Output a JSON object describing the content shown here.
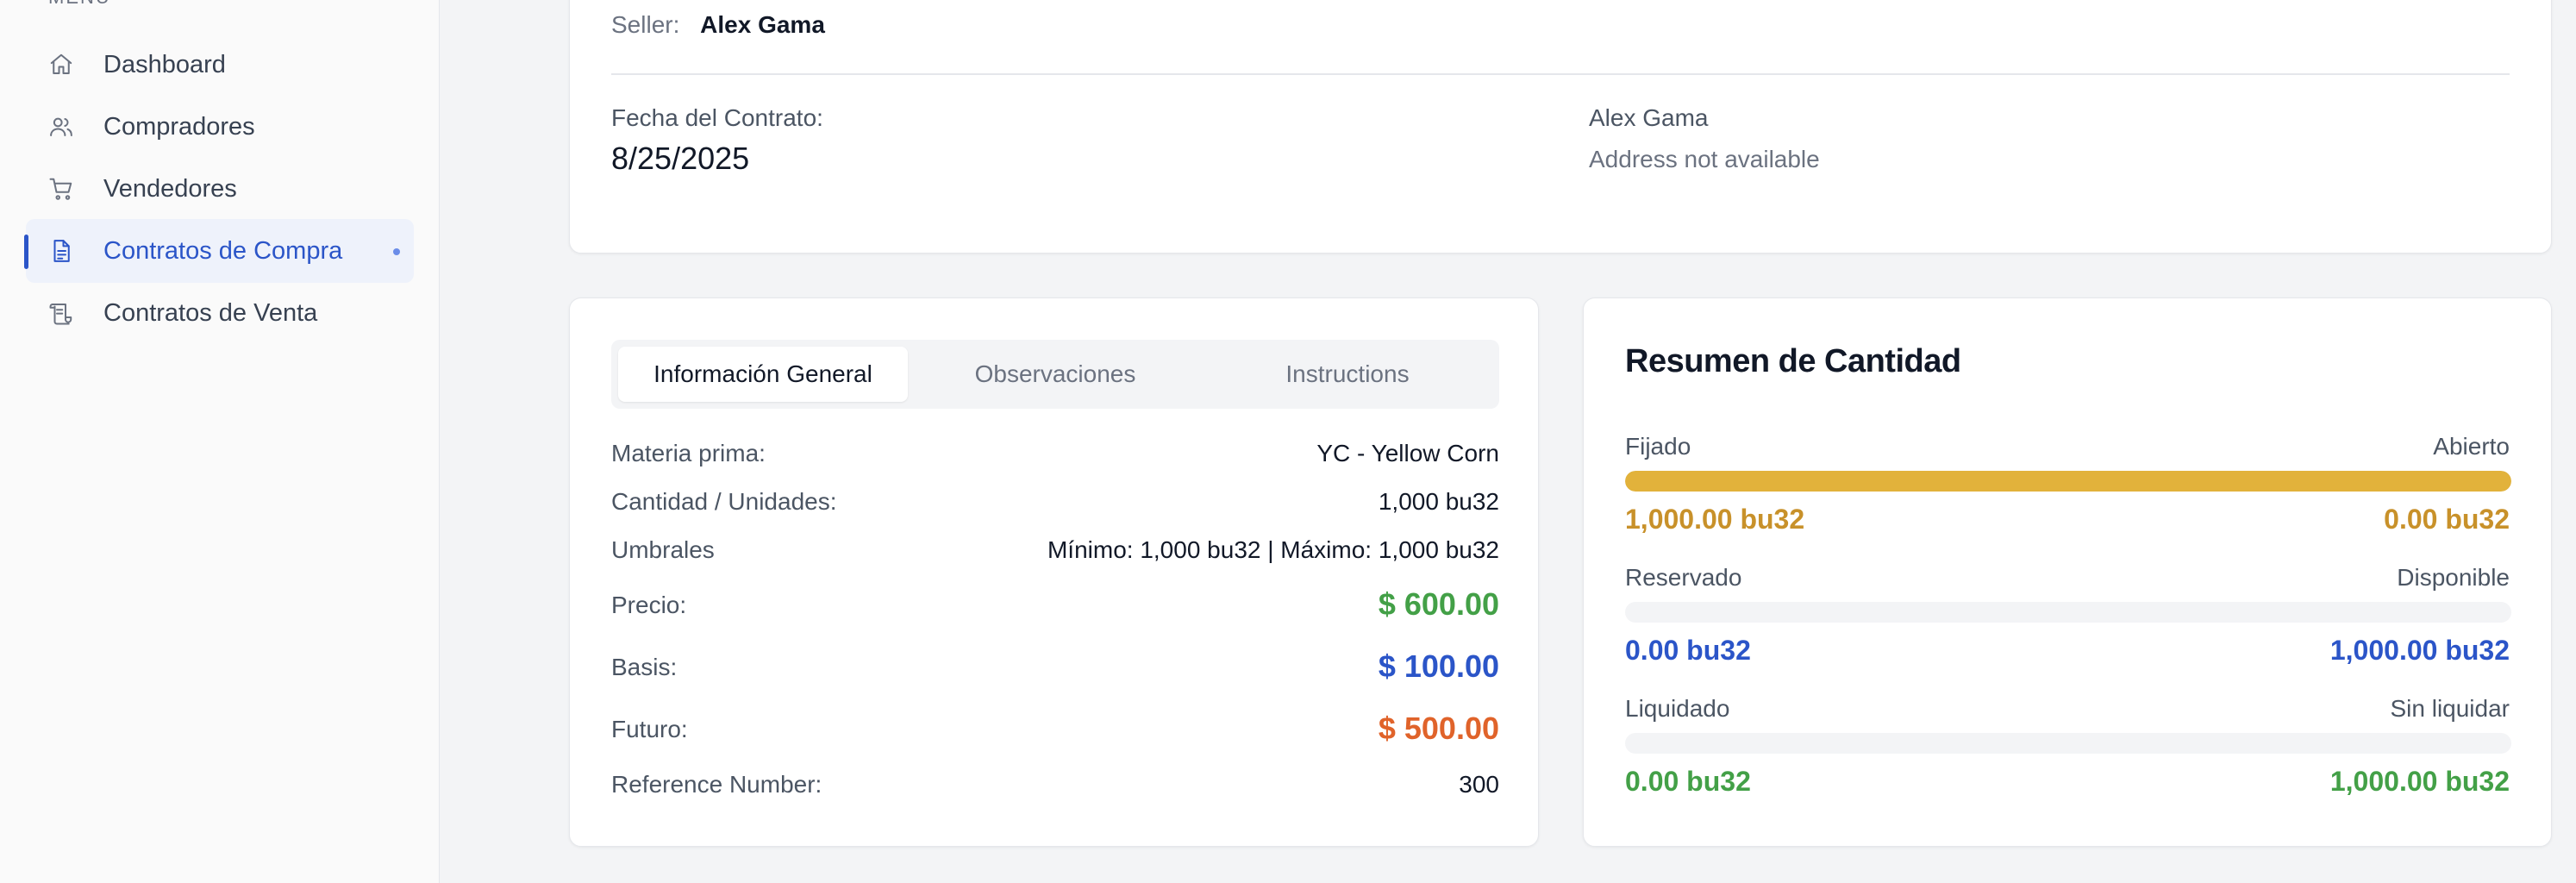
{
  "sidebar": {
    "menu_label": "MENU",
    "items": [
      {
        "label": "Dashboard",
        "icon": "home-icon"
      },
      {
        "label": "Compradores",
        "icon": "users-icon"
      },
      {
        "label": "Vendedores",
        "icon": "cart-icon"
      },
      {
        "label": "Contratos de Compra",
        "icon": "document-icon",
        "active": true
      },
      {
        "label": "Contratos de Venta",
        "icon": "scroll-icon"
      }
    ],
    "accent_color": "#2b55c8"
  },
  "contract_header": {
    "seller_label": "Seller:",
    "seller_name": "Alex Gama",
    "date_label": "Fecha del Contrato:",
    "date_value": "8/25/2025",
    "party_name": "Alex Gama",
    "party_address": "Address not available"
  },
  "info": {
    "tabs": [
      "Información General",
      "Observaciones",
      "Instructions"
    ],
    "active_tab": "Información General",
    "rows": {
      "materia_label": "Materia prima:",
      "materia_value": "YC - Yellow Corn",
      "cantidad_label": "Cantidad / Unidades:",
      "cantidad_value": "1,000 bu32",
      "umbrales_label": "Umbrales",
      "umbrales_value": "Mínimo: 1,000 bu32 | Máximo: 1,000 bu32",
      "precio_label": "Precio:",
      "precio_value": "$ 600.00",
      "basis_label": "Basis:",
      "basis_value": "$ 100.00",
      "futuro_label": "Futuro:",
      "futuro_value": "$ 500.00",
      "reference_label": "Reference Number:",
      "reference_value": "300"
    }
  },
  "summary": {
    "title": "Resumen de Cantidad",
    "fijado_label": "Fijado",
    "abierto_label": "Abierto",
    "fijado_value": "1,000.00 bu32",
    "abierto_value": "0.00 bu32",
    "fijado_progress": 1.0,
    "reservado_label": "Reservado",
    "disponible_label": "Disponible",
    "reservado_value": "0.00 bu32",
    "disponible_value": "1,000.00 bu32",
    "reservado_progress": 0.0,
    "liquidado_label": "Liquidado",
    "sin_liquidar_label": "Sin liquidar",
    "liquidado_value": "0.00 bu32",
    "sin_liquidar_value": "1,000.00 bu32",
    "liquidado_progress": 0.0,
    "colors": {
      "gold": "#c8912a",
      "bar": "#e2b23b",
      "blue": "#2b55c8",
      "green": "#43a047",
      "orange": "#e0632a"
    }
  }
}
